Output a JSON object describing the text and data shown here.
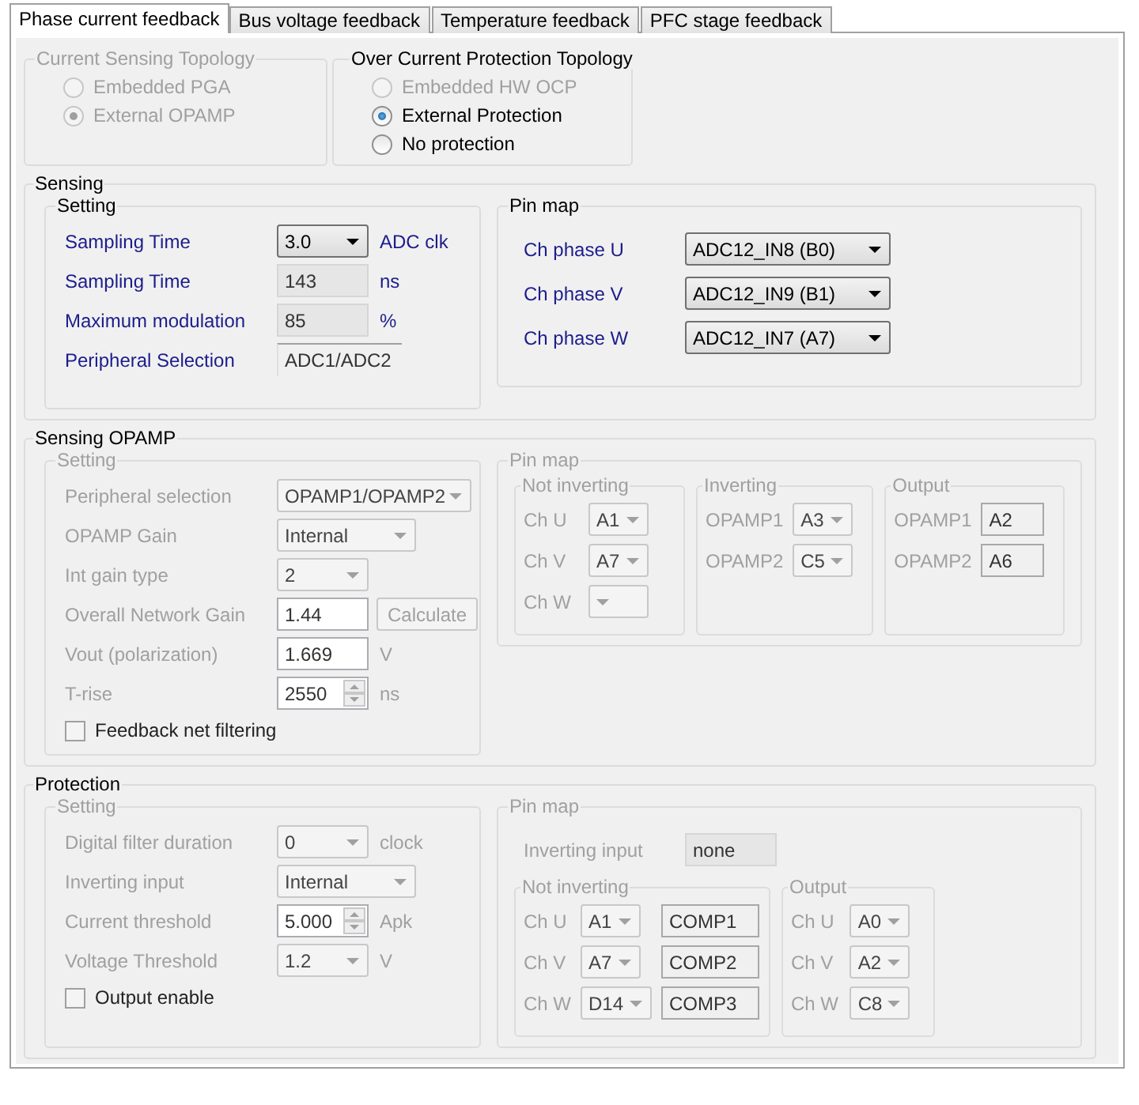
{
  "tabs": [
    {
      "label": "Phase current feedback",
      "selected": true
    },
    {
      "label": "Bus voltage feedback",
      "selected": false
    },
    {
      "label": "Temperature feedback",
      "selected": false
    },
    {
      "label": "PFC stage feedback",
      "selected": false
    }
  ],
  "topology_groups": [
    {
      "title": "Current Sensing Topology",
      "disabled": true,
      "options": [
        {
          "label": "Embedded PGA",
          "selected": false,
          "disabled": true
        },
        {
          "label": "External OPAMP",
          "selected": true,
          "disabled": true
        }
      ]
    },
    {
      "title": "Over Current Protection Topology",
      "disabled": false,
      "options": [
        {
          "label": "Embedded HW OCP",
          "selected": false,
          "disabled": true
        },
        {
          "label": "External Protection",
          "selected": true,
          "disabled": false
        },
        {
          "label": "No protection",
          "selected": false,
          "disabled": false
        }
      ]
    }
  ],
  "sections": [
    {
      "title": "Sensing",
      "setting": {
        "title": "Setting",
        "disabled": false,
        "rows": [
          {
            "label": "Sampling Time",
            "controls": [
              {
                "kind": "combo",
                "value": "3.0"
              }
            ],
            "unit": "ADC clk"
          },
          {
            "label": "Sampling Time",
            "controls": [
              {
                "kind": "readonly",
                "value": "143"
              }
            ],
            "unit": "ns"
          },
          {
            "label": "Maximum modulation",
            "controls": [
              {
                "kind": "readonly",
                "value": "85"
              }
            ],
            "unit": "%"
          },
          {
            "label": "Peripheral Selection",
            "controls": [
              {
                "kind": "flat",
                "value": "ADC1/ADC2"
              }
            ]
          }
        ]
      },
      "pin_map": {
        "title": "Pin map",
        "disabled": false,
        "rows": [
          {
            "label": "Ch phase U",
            "controls": [
              {
                "kind": "combo",
                "value": "ADC12_IN8 (B0)"
              }
            ]
          },
          {
            "label": "Ch phase V",
            "controls": [
              {
                "kind": "combo",
                "value": "ADC12_IN9 (B1)"
              }
            ]
          },
          {
            "label": "Ch phase W",
            "controls": [
              {
                "kind": "combo",
                "value": "ADC12_IN7 (A7)"
              }
            ]
          }
        ]
      }
    },
    {
      "title": "Sensing OPAMP",
      "setting": {
        "title": "Setting",
        "disabled": true,
        "rows": [
          {
            "label": "Peripheral selection",
            "controls": [
              {
                "kind": "combo",
                "value": "OPAMP1/OPAMP2"
              }
            ]
          },
          {
            "label": "OPAMP Gain",
            "controls": [
              {
                "kind": "combo",
                "value": "Internal"
              }
            ]
          },
          {
            "label": "Int gain type",
            "controls": [
              {
                "kind": "combo",
                "value": "2"
              }
            ]
          },
          {
            "label": "Overall Network Gain",
            "controls": [
              {
                "kind": "text",
                "value": "1.44"
              },
              {
                "kind": "button",
                "value": "Calculate"
              }
            ]
          },
          {
            "label": "Vout (polarization)",
            "controls": [
              {
                "kind": "text",
                "value": "1.669"
              }
            ],
            "unit": "V"
          },
          {
            "label": "T-rise",
            "controls": [
              {
                "kind": "spin",
                "value": "2550"
              }
            ],
            "unit": "ns"
          }
        ],
        "checkbox": {
          "label": "Feedback net filtering",
          "checked": false
        }
      },
      "pin_map": {
        "title": "Pin map",
        "disabled": true,
        "subgroups": [
          {
            "title": "Not inverting",
            "rows": [
              {
                "label": "Ch U",
                "controls": [
                  {
                    "kind": "combo",
                    "value": "A1"
                  }
                ]
              },
              {
                "label": "Ch V",
                "controls": [
                  {
                    "kind": "combo",
                    "value": "A7"
                  }
                ]
              },
              {
                "label": "Ch W",
                "controls": [
                  {
                    "kind": "combo"
                  }
                ]
              }
            ]
          },
          {
            "title": "Inverting",
            "rows": [
              {
                "label": "OPAMP1",
                "controls": [
                  {
                    "kind": "combo",
                    "value": "A3"
                  }
                ]
              },
              {
                "label": "OPAMP2",
                "controls": [
                  {
                    "kind": "combo",
                    "value": "C5"
                  }
                ]
              }
            ]
          },
          {
            "title": "Output",
            "rows": [
              {
                "label": "OPAMP1",
                "controls": [
                  {
                    "kind": "readonly",
                    "value": "A2"
                  }
                ]
              },
              {
                "label": "OPAMP2",
                "controls": [
                  {
                    "kind": "readonly",
                    "value": "A6"
                  }
                ]
              }
            ]
          }
        ]
      }
    },
    {
      "title": "Protection",
      "setting": {
        "title": "Setting",
        "disabled": true,
        "rows": [
          {
            "label": "Digital filter duration",
            "controls": [
              {
                "kind": "combo",
                "value": "0"
              }
            ],
            "unit": "clock"
          },
          {
            "label": "Inverting input",
            "controls": [
              {
                "kind": "combo",
                "value": "Internal"
              }
            ]
          },
          {
            "label": "Current threshold",
            "controls": [
              {
                "kind": "spin",
                "value": "5.000"
              }
            ],
            "unit": "Apk"
          },
          {
            "label": "Voltage Threshold",
            "controls": [
              {
                "kind": "combo",
                "value": "1.2"
              }
            ],
            "unit": "V"
          }
        ],
        "checkbox": {
          "label": "Output enable",
          "checked": false
        }
      },
      "pin_map": {
        "title": "Pin map",
        "disabled": true,
        "rows": [
          {
            "label": "Inverting input",
            "controls": [
              {
                "kind": "readonly",
                "value": "none"
              }
            ]
          }
        ],
        "subgroups": [
          {
            "title": "Not inverting",
            "rows": [
              {
                "label": "Ch U",
                "controls": [
                  {
                    "kind": "combo",
                    "value": "A1"
                  },
                  {
                    "kind": "readonly",
                    "value": "COMP1"
                  }
                ]
              },
              {
                "label": "Ch V",
                "controls": [
                  {
                    "kind": "combo",
                    "value": "A7"
                  },
                  {
                    "kind": "readonly",
                    "value": "COMP2"
                  }
                ]
              },
              {
                "label": "Ch W",
                "controls": [
                  {
                    "kind": "combo",
                    "value": "D14"
                  },
                  {
                    "kind": "readonly",
                    "value": "COMP3"
                  }
                ]
              }
            ]
          },
          {
            "title": "Output",
            "rows": [
              {
                "label": "Ch U",
                "controls": [
                  {
                    "kind": "combo",
                    "value": "A0"
                  }
                ]
              },
              {
                "label": "Ch V",
                "controls": [
                  {
                    "kind": "combo",
                    "value": "A2"
                  }
                ]
              },
              {
                "label": "Ch W",
                "controls": [
                  {
                    "kind": "combo",
                    "value": "C8"
                  }
                ]
              }
            ]
          }
        ]
      }
    }
  ]
}
